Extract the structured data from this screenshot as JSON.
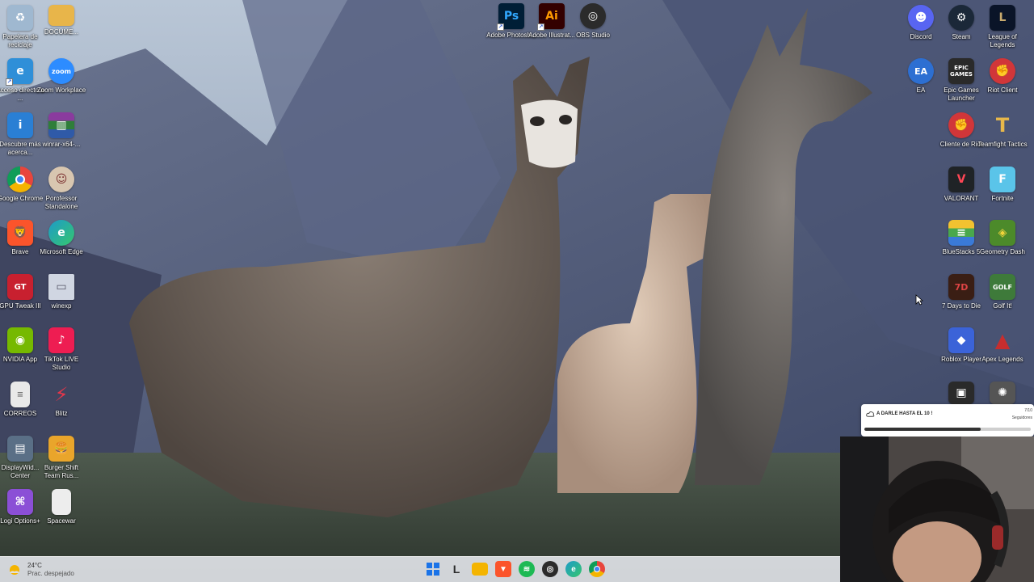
{
  "desktop": {
    "left_col1": [
      {
        "label": "Papelera de reciclaje",
        "icon": "recycle-bin-icon",
        "color": "#9fb8d0"
      },
      {
        "label": "Acceso directo a ...",
        "icon": "edge-shortcut-icon",
        "color": "#2f8fd8"
      },
      {
        "label": "Descubre más acerca...",
        "icon": "info-icon",
        "color": "#2a7fd4"
      },
      {
        "label": "Google Chrome",
        "icon": "chrome-icon",
        "color": "#e8453c"
      },
      {
        "label": "Brave",
        "icon": "brave-icon",
        "color": "#fb542b"
      },
      {
        "label": "GPU Tweak III",
        "icon": "gpu-tweak-icon",
        "color": "#c8202f"
      },
      {
        "label": "NVIDIA App",
        "icon": "nvidia-icon",
        "color": "#76b900"
      },
      {
        "label": "CORREOS",
        "icon": "document-icon",
        "color": "#e9e9e9"
      },
      {
        "label": "DisplayWid... Center",
        "icon": "display-icon",
        "color": "#5a6f86"
      },
      {
        "label": "Logi Options+",
        "icon": "logi-icon",
        "color": "#8b4fd6"
      }
    ],
    "left_col2": [
      {
        "label": "DOCUME...",
        "icon": "folder-icon",
        "color": "#e8b54a"
      },
      {
        "label": "Zoom Workplace",
        "icon": "zoom-icon",
        "color": "#2d8cff"
      },
      {
        "label": "winrar-x64-...",
        "icon": "winrar-icon",
        "color": "#8a3b9e"
      },
      {
        "label": "Porofessor Standalone",
        "icon": "porofessor-icon",
        "color": "#d8c6b0"
      },
      {
        "label": "Microsoft Edge",
        "icon": "edge-icon",
        "color": "#1d9bc9"
      },
      {
        "label": "winexp",
        "icon": "window-icon",
        "color": "#d0d6e2"
      },
      {
        "label": "TikTok LIVE Studio",
        "icon": "tiktok-icon",
        "color": "#ee1d52"
      },
      {
        "label": "Blitz",
        "icon": "blitz-icon",
        "color": "#e8364a"
      },
      {
        "label": "Burger Shift Team Rus...",
        "icon": "burger-shift-icon",
        "color": "#e9a52b"
      },
      {
        "label": "Spacewar",
        "icon": "blank-file-icon",
        "color": "#ededed"
      }
    ],
    "top_center": [
      {
        "label": "Adobe Photosh...",
        "icon": "photoshop-icon",
        "color": "#001e36",
        "text": "Ps",
        "text_color": "#31a8ff"
      },
      {
        "label": "Adobe Illustrat...",
        "icon": "illustrator-icon",
        "color": "#330000",
        "text": "Ai",
        "text_color": "#ff9a00"
      },
      {
        "label": "OBS Studio",
        "icon": "obs-icon",
        "color": "#2b2b2b",
        "text": "",
        "text_color": "#fff"
      }
    ],
    "right_col1": [
      {
        "label": "Discord",
        "icon": "discord-icon",
        "color": "#5865f2"
      },
      {
        "label": "EA",
        "icon": "ea-icon",
        "color": "#2d6fd2"
      },
      {
        "label": "",
        "icon": "",
        "color": ""
      },
      {
        "label": "",
        "icon": "",
        "color": ""
      },
      {
        "label": "",
        "icon": "",
        "color": ""
      },
      {
        "label": "",
        "icon": "",
        "color": ""
      },
      {
        "label": "",
        "icon": "",
        "color": ""
      }
    ],
    "right_col2": [
      {
        "label": "Steam",
        "icon": "steam-icon",
        "color": "#1b2838"
      },
      {
        "label": "Epic Games Launcher",
        "icon": "epic-icon",
        "color": "#2a2a2a"
      },
      {
        "label": "Cliente de Riot",
        "icon": "riot-icon",
        "color": "#d13639"
      },
      {
        "label": "VALORANT",
        "icon": "valorant-icon",
        "color": "#1f2326"
      },
      {
        "label": "BlueStacks 5",
        "icon": "bluestacks-icon",
        "color": "#49a84c"
      },
      {
        "label": "7 Days to Die",
        "icon": "seven-days-icon",
        "color": "#3a1e14"
      },
      {
        "label": "Roblox Player",
        "icon": "roblox-icon",
        "color": "#3b63d8"
      },
      {
        "label": "",
        "icon": "partial-icon",
        "color": "#2a2a2a"
      }
    ],
    "right_col3": [
      {
        "label": "League of Legends",
        "icon": "lol-icon",
        "color": "#0a1428"
      },
      {
        "label": "Riot Client",
        "icon": "riot-client-icon",
        "color": "#d13639"
      },
      {
        "label": "Teamfight Tactics",
        "icon": "tft-icon",
        "color": "#0f2a3a"
      },
      {
        "label": "Fortnite",
        "icon": "fortnite-icon",
        "color": "#5ac4e9"
      },
      {
        "label": "Geometry Dash",
        "icon": "geometry-dash-icon",
        "color": "#4c8a2a"
      },
      {
        "label": "Golf It!",
        "icon": "golf-it-icon",
        "color": "#3e7a3a"
      },
      {
        "label": "Apex Legends",
        "icon": "apex-icon",
        "color": "#c72e2e"
      },
      {
        "label": "",
        "icon": "partial-icon",
        "color": "#555555"
      }
    ]
  },
  "taskbar": {
    "weather": {
      "temp": "24°C",
      "condition": "Prac. despejado"
    },
    "apps": [
      {
        "name": "start-icon",
        "color": "#1a73e8"
      },
      {
        "name": "terminal-icon",
        "color": "#2b2b2b"
      },
      {
        "name": "file-explorer-icon",
        "color": "#f4b400"
      },
      {
        "name": "brave-taskbar-icon",
        "color": "#fb542b"
      },
      {
        "name": "spotify-icon",
        "color": "#1db954"
      },
      {
        "name": "obs-taskbar-icon",
        "color": "#2b2b2b"
      },
      {
        "name": "edge-taskbar-icon",
        "color": "#1d9bc9"
      },
      {
        "name": "chrome-taskbar-icon",
        "color": "#e8453c"
      }
    ]
  },
  "widget": {
    "title": "A DARLE HASTA EL 10 !",
    "count": "7/10",
    "unit": "Seguidores",
    "progress": 0.7
  }
}
